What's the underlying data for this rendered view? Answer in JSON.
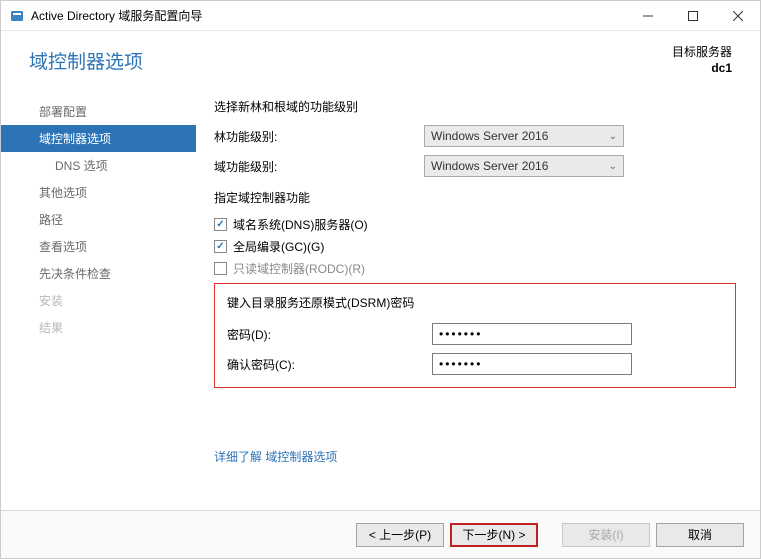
{
  "titlebar": {
    "title": "Active Directory 域服务配置向导"
  },
  "header": {
    "page_title": "域控制器选项",
    "target_label": "目标服务器",
    "target_server": "dc1"
  },
  "sidebar": {
    "items": [
      {
        "label": "部署配置",
        "state": "normal"
      },
      {
        "label": "域控制器选项",
        "state": "selected"
      },
      {
        "label": "DNS 选项",
        "state": "indent"
      },
      {
        "label": "其他选项",
        "state": "normal"
      },
      {
        "label": "路径",
        "state": "normal"
      },
      {
        "label": "查看选项",
        "state": "normal"
      },
      {
        "label": "先决条件检查",
        "state": "normal"
      },
      {
        "label": "安装",
        "state": "disabled"
      },
      {
        "label": "结果",
        "state": "disabled"
      }
    ]
  },
  "main": {
    "func_level_heading": "选择新林和根域的功能级别",
    "forest_level_label": "林功能级别:",
    "domain_level_label": "域功能级别:",
    "forest_level_value": "Windows Server 2016",
    "domain_level_value": "Windows Server 2016",
    "dc_capabilities_heading": "指定域控制器功能",
    "chk_dns_label": "域名系统(DNS)服务器(O)",
    "chk_gc_label": "全局编录(GC)(G)",
    "chk_rodc_label": "只读域控制器(RODC)(R)",
    "dsrm_heading": "键入目录服务还原模式(DSRM)密码",
    "password_label": "密码(D):",
    "confirm_password_label": "确认密码(C):",
    "password_value": "•••••••",
    "confirm_password_value": "•••••••",
    "learn_more_link": "详细了解 域控制器选项"
  },
  "footer": {
    "prev": "< 上一步(P)",
    "next": "下一步(N) >",
    "install": "安装(I)",
    "cancel": "取消"
  }
}
